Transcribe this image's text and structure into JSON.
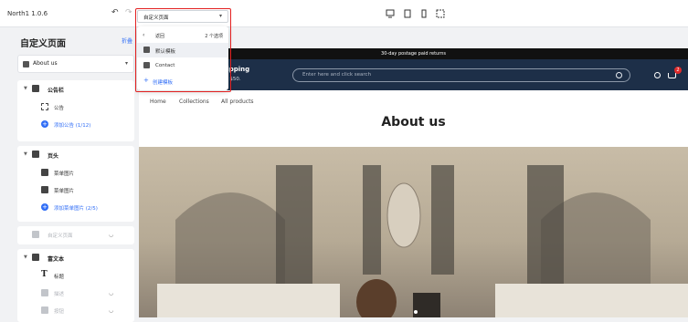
{
  "app": {
    "version": "North1 1.0.6"
  },
  "toolbar": {
    "undo_icon": "undo-icon",
    "redo_icon": "redo-icon",
    "devices": [
      "desktop-icon",
      "tablet-icon",
      "mobile-icon",
      "fullscreen-icon"
    ]
  },
  "sidebar": {
    "title": "自定义页面",
    "fold_label": "折叠",
    "page_select": "About us",
    "groups": [
      {
        "label": "公告栏",
        "rows": [
          {
            "label": "公告"
          },
          {
            "label": "添加公告 (1/12)"
          }
        ]
      },
      {
        "label": "页头",
        "rows": [
          {
            "label": "菜单图片"
          },
          {
            "label": "菜单图片"
          },
          {
            "label": "添加菜单图片 (2/5)"
          }
        ]
      },
      {
        "label": "自定义页面"
      },
      {
        "label": "富文本",
        "rows": [
          {
            "label": "标题"
          },
          {
            "label": "描述"
          },
          {
            "label": "按钮"
          }
        ]
      }
    ]
  },
  "template_select": {
    "value": "自定义页面",
    "menu": {
      "back_label": "返回",
      "count_label": "2 个选项",
      "items": [
        {
          "label": "默认模板"
        },
        {
          "label": "Contact"
        }
      ],
      "create_label": "创建模板"
    }
  },
  "preview": {
    "announcement": "30-day postage paid returns",
    "header_line1": "e shipping",
    "header_line2": "ped at $50.",
    "search_placeholder": "Enter here and click search",
    "cart_count": "2",
    "nav": [
      "Home",
      "Collections",
      "All products"
    ],
    "page_title": "About us"
  }
}
